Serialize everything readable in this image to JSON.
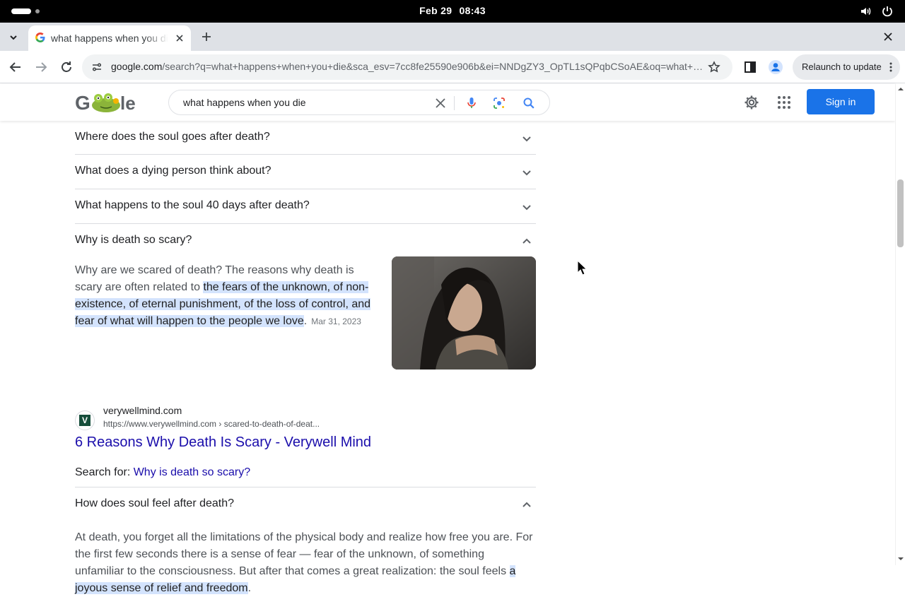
{
  "os": {
    "date": "Feb 29",
    "time": "08:43"
  },
  "browser": {
    "tab_title": "what happens when you die - Google Search",
    "url_host": "google.com",
    "url_path": "/search?q=what+happens+when+you+die&sca_esv=7cc8fe25590e906b&ei=NNDgZY3_OpTL1sQPqbCSoAE&oq=what+h...",
    "relaunch_label": "Relaunch to update"
  },
  "header": {
    "search_query": "what happens when you die",
    "signin_label": "Sign in"
  },
  "faq": {
    "q1": "Where does the soul goes after death?",
    "q2": "What does a dying person think about?",
    "q3": "What happens to the soul 40 days after death?",
    "q4": "Why is death so scary?",
    "q5": "How does soul feel after death?"
  },
  "answer1": {
    "text_plain": "Why are we scared of death? The reasons why death is scary are often related to ",
    "text_highlight": "the fears of the unknown, of non-existence, of eternal punishment, of the loss of control, and fear of what will happen to the people we love",
    "text_end": ".",
    "date": "Mar 31, 2023"
  },
  "source": {
    "favicon_letter": "V",
    "site_name": "verywellmind.com",
    "site_url": "https://www.verywellmind.com › scared-to-death-of-deat...",
    "title": "6 Reasons Why Death Is Scary - Verywell Mind"
  },
  "search_for": {
    "label": "Search for: ",
    "link": "Why is death so scary?"
  },
  "answer2": {
    "text_plain": "At death, you forget all the limitations of the physical body and realize how free you are. For the first few seconds there is a sense of fear — fear of the unknown, of something unfamiliar to the consciousness. But after that comes a great realization: the soul feels ",
    "text_highlight": "a joyous sense of relief and freedom",
    "text_end": "."
  },
  "colors": {
    "link": "#1a0dab",
    "accent": "#1a73e8",
    "highlight": "#d3e3fd"
  }
}
